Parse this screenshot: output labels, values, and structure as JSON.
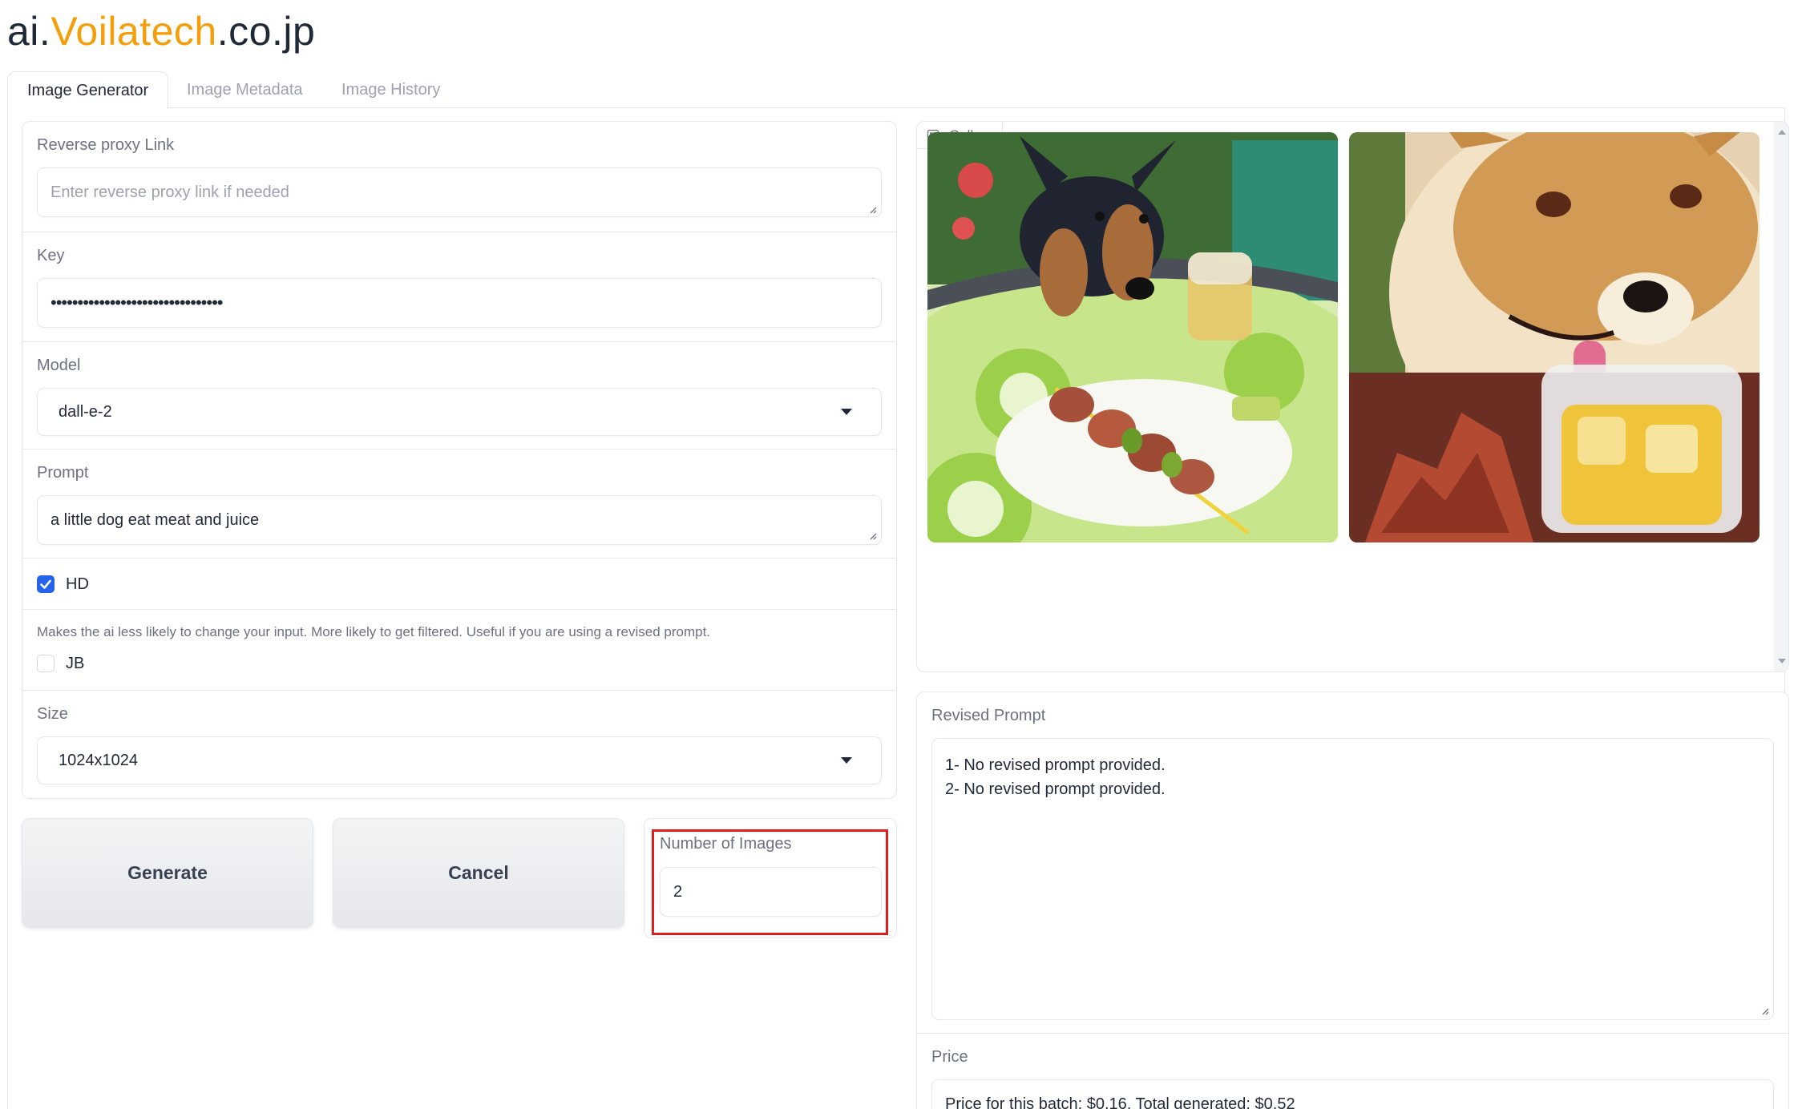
{
  "logo": {
    "prefix": "ai.",
    "brand": "Voilatech",
    "suffix": ".co.jp"
  },
  "tabs": [
    {
      "label": "Image Generator",
      "active": true
    },
    {
      "label": "Image Metadata",
      "active": false
    },
    {
      "label": "Image History",
      "active": false
    }
  ],
  "form": {
    "proxy": {
      "label": "Reverse proxy Link",
      "placeholder": "Enter reverse proxy link if needed",
      "value": ""
    },
    "key": {
      "label": "Key",
      "value": "••••••••••••••••••••••••••••••••"
    },
    "model": {
      "label": "Model",
      "value": "dall-e-2"
    },
    "prompt": {
      "label": "Prompt",
      "value": "a little dog eat meat and juice"
    },
    "hd": {
      "label": "HD",
      "checked": true
    },
    "jb": {
      "info": "Makes the ai less likely to change your input. More likely to get filtered. Useful if you are using a revised prompt.",
      "label": "JB",
      "checked": false
    },
    "size": {
      "label": "Size",
      "value": "1024x1024"
    },
    "num_images": {
      "label": "Number of Images",
      "value": "2"
    }
  },
  "buttons": {
    "generate": "Generate",
    "cancel": "Cancel"
  },
  "gallery": {
    "label": "Gallery"
  },
  "revised": {
    "label": "Revised Prompt",
    "lines": [
      "1- No revised prompt provided.",
      "2- No revised prompt provided."
    ]
  },
  "price": {
    "label": "Price",
    "value": "Price for this batch: $0.16, Total generated: $0.52"
  },
  "colors": {
    "accent": "#2563eb",
    "brand": "#f59e0b",
    "highlight": "#e11d1d"
  }
}
